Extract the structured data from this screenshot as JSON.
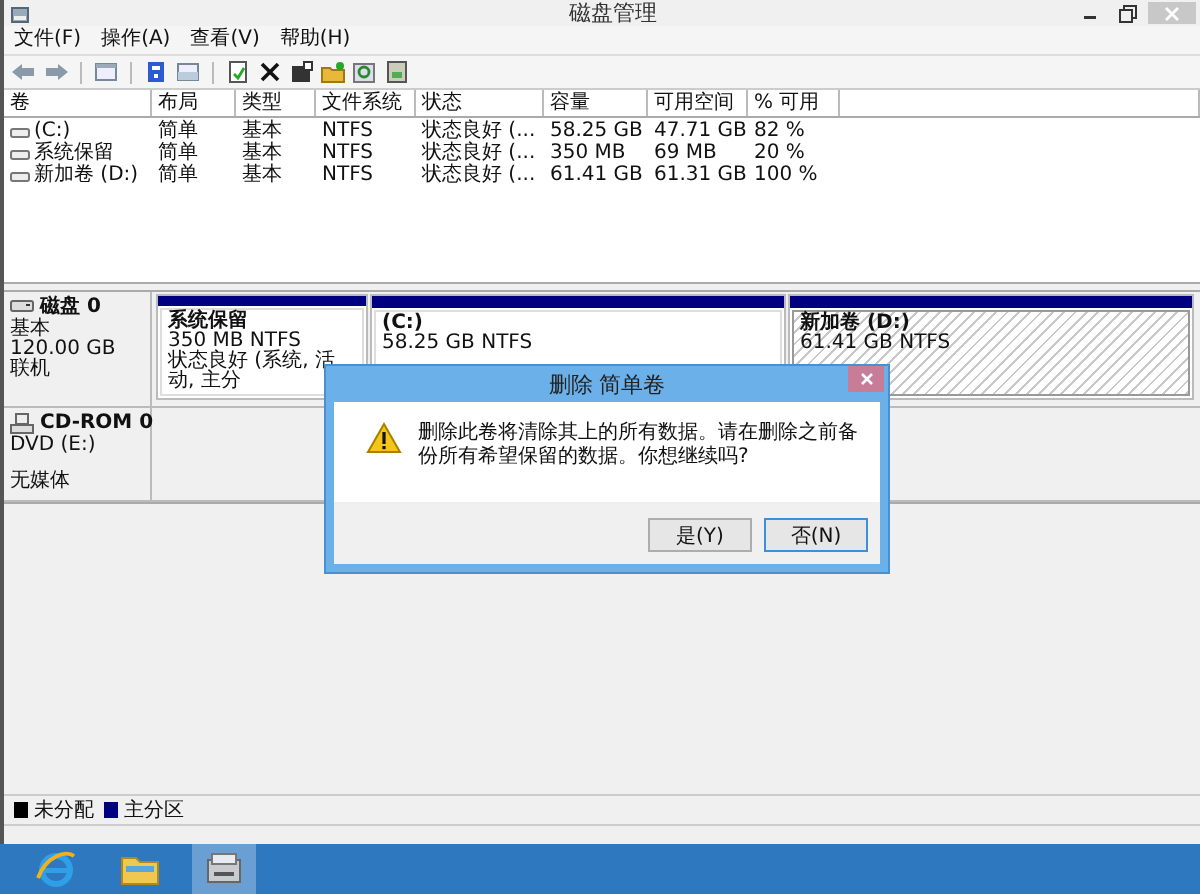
{
  "window": {
    "title": "磁盘管理"
  },
  "menu": [
    "文件(F)",
    "操作(A)",
    "查看(V)",
    "帮助(H)"
  ],
  "volume_table": {
    "columns": [
      "卷",
      "布局",
      "类型",
      "文件系统",
      "状态",
      "容量",
      "可用空间",
      "% 可用"
    ],
    "rows": [
      {
        "cells": [
          "(C:)",
          "简单",
          "基本",
          "NTFS",
          "状态良好 (...",
          "58.25 GB",
          "47.71 GB",
          "82 %"
        ]
      },
      {
        "cells": [
          "系统保留",
          "简单",
          "基本",
          "NTFS",
          "状态良好 (...",
          "350 MB",
          "69 MB",
          "20 %"
        ]
      },
      {
        "cells": [
          "新加卷 (D:)",
          "简单",
          "基本",
          "NTFS",
          "状态良好 (...",
          "61.41 GB",
          "61.31 GB",
          "100 %"
        ]
      }
    ]
  },
  "disks": [
    {
      "kind": "hdd",
      "name": "磁盘 0",
      "lines": [
        "基本",
        "120.00 GB",
        "联机"
      ],
      "partitions": [
        {
          "title": "系统保留",
          "lines": [
            "350 MB NTFS",
            "状态良好 (系统, 活动, 主分"
          ],
          "selected": false
        },
        {
          "title": "(C:)",
          "lines": [
            "58.25 GB NTFS"
          ],
          "selected": false
        },
        {
          "title": "新加卷  (D:)",
          "lines": [
            "61.41 GB NTFS"
          ],
          "selected": true
        }
      ]
    },
    {
      "kind": "cdrom",
      "name": "CD-ROM 0",
      "lines": [
        "DVD (E:)",
        "无媒体"
      ]
    }
  ],
  "legend": [
    {
      "label": "未分配",
      "color": "#000000"
    },
    {
      "label": "主分区",
      "color": "#000080"
    }
  ],
  "dialog": {
    "title": "删除 简单卷",
    "message": "删除此卷将清除其上的所有数据。请在删除之前备份所有希望保留的数据。你想继续吗?",
    "buttons": [
      {
        "label": "是(Y)",
        "focused": false
      },
      {
        "label": "否(N)",
        "focused": true
      }
    ]
  },
  "taskbar": [
    {
      "kind": "browser",
      "selected": false
    },
    {
      "kind": "explorer",
      "selected": false
    },
    {
      "kind": "diskmgmt",
      "selected": true
    }
  ]
}
